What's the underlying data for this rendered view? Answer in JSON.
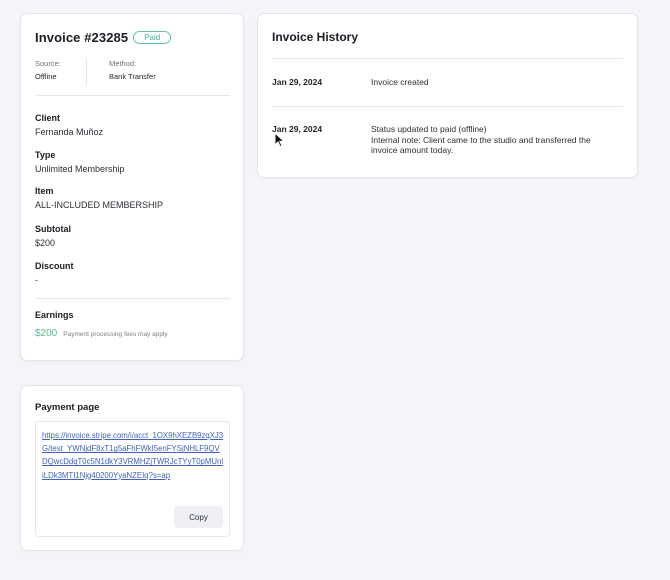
{
  "invoice": {
    "title": "Invoice #23285",
    "status_badge": "Paid",
    "source_label": "Source:",
    "source_value": "Offline",
    "method_label": "Method:",
    "method_value": "Bank Transfer",
    "fields": [
      {
        "label": "Client",
        "value": "Fernanda Muñoz"
      },
      {
        "label": "Type",
        "value": "Unlimited Membership"
      },
      {
        "label": "Item",
        "value": "ALL-INCLUDED MEMBERSHIP"
      },
      {
        "label": "Subtotal",
        "value": "$200"
      },
      {
        "label": "Discount",
        "value": "-"
      }
    ],
    "earnings_label": "Earnings",
    "earnings_value": "$200",
    "earnings_note": "Payment processing fees may apply"
  },
  "payment_page": {
    "title": "Payment page",
    "url": "https://invoice.stripe.com/i/acct_1OX9hXEZB9zqXJ3G/test_YWNjdF8xT1g5aFhFWkI5enFYSjNHLF9QVDQwcDdqT0c5N1dkY3VRMHZjTWRJcTYyT0pMUnliLDk3MTI1Njg40200YyaNZEIq?s=ap",
    "copy_label": "Copy"
  },
  "history": {
    "title": "Invoice History",
    "entries": [
      {
        "date": "Jan 29, 2024",
        "lines": [
          "Invoice created"
        ]
      },
      {
        "date": "Jan 29, 2024",
        "lines": [
          "Status updated to paid (offline)",
          "Internal note: Client came to the studio and transferred the invoice amount today."
        ]
      }
    ]
  },
  "colors": {
    "background": "#f4f5f8",
    "paid_green": "#45b08c",
    "earnings_green": "#56b88f",
    "link_blue": "#3f63b8"
  },
  "icons": {
    "cursor": "mouse-pointer-icon"
  }
}
